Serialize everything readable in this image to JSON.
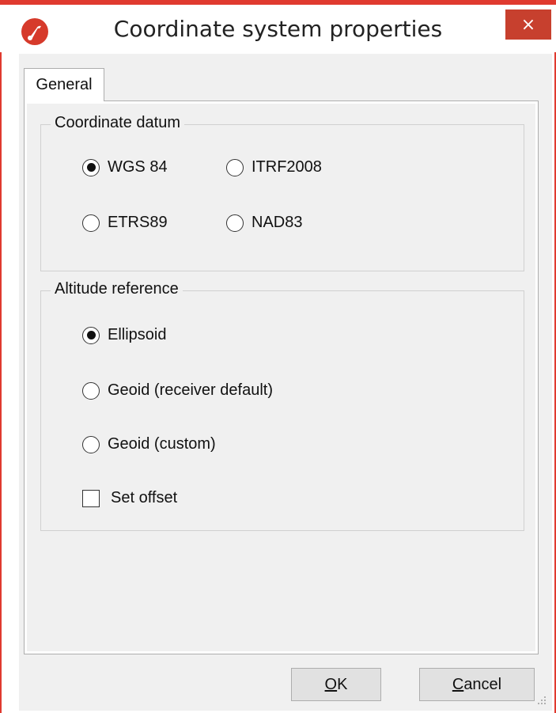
{
  "window": {
    "title": "Coordinate system properties",
    "close_glyph": "×",
    "app_icon": "app-logo-icon",
    "accent_color": "#e03a2f"
  },
  "tabs": [
    {
      "label": "General",
      "selected": true
    }
  ],
  "coordinate_datum": {
    "legend": "Coordinate datum",
    "options": [
      {
        "label": "WGS 84",
        "selected": true
      },
      {
        "label": "ITRF2008",
        "selected": false
      },
      {
        "label": "ETRS89",
        "selected": false
      },
      {
        "label": "NAD83",
        "selected": false
      }
    ]
  },
  "altitude_reference": {
    "legend": "Altitude reference",
    "options": [
      {
        "label": "Ellipsoid",
        "selected": true
      },
      {
        "label": "Geoid (receiver default)",
        "selected": false
      },
      {
        "label": "Geoid (custom)",
        "selected": false
      }
    ],
    "set_offset": {
      "label": "Set offset",
      "checked": false
    }
  },
  "buttons": {
    "ok": "OK",
    "cancel": "Cancel"
  }
}
